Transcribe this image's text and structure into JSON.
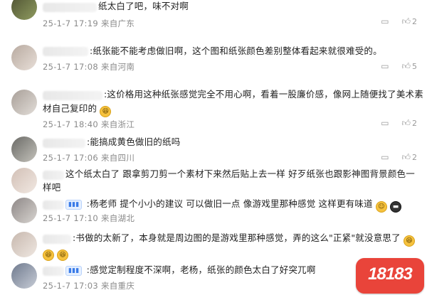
{
  "comments": [
    {
      "text": "纸太白了吧，味不对啊",
      "date": "25-1-7 17:19",
      "location": "来自广东",
      "likes": "2"
    },
    {
      "text": ":纸张能不能考虑做旧啊，这个图和纸张颜色差别整体看起来就很难受的。",
      "date": "25-1-7 17:08",
      "location": "来自河南",
      "likes": "5"
    },
    {
      "line1": ":这价格用这种纸张感觉完全不用心啊，看着一股廉价感，像网上随便找了美术素",
      "line2": "材自己复印的",
      "date": "25-1-7 18:40",
      "location": "来自浙江",
      "likes": "2"
    },
    {
      "text": ":能搞成黄色做旧的纸吗",
      "date": "25-1-7 17:06",
      "location": "来自四川",
      "likes": "2"
    },
    {
      "line1": "这个纸太白了 跟拿剪刀剪一个素材下来然后贴上去一样  好歹纸张也跟影神图背景颜色一",
      "line2": "样吧",
      "date": "",
      "location": "",
      "likes": ""
    },
    {
      "text": ":杨老师 提个小小的建议 可以做旧一点 像游戏里那种感觉 这样更有味道",
      "date": "25-1-7 17:10",
      "location": "来自湖北",
      "likes": ""
    },
    {
      "line1": ":书做的太新了，本身就是周边图的是游戏里那种感觉，弄的这么\"正紧\"就没意思了",
      "date": "",
      "location": "",
      "likes": ""
    },
    {
      "text": ":感觉定制程度不深啊，老杨，纸张的颜色太白了好突兀啊",
      "date": "25-1-7 17:03",
      "location": "来自重庆",
      "likes": ""
    }
  ],
  "icons": {
    "comment": "comment-icon",
    "like": "thumbs-up-icon"
  },
  "logo": {
    "text": "18183",
    "color": "#e9443a"
  }
}
